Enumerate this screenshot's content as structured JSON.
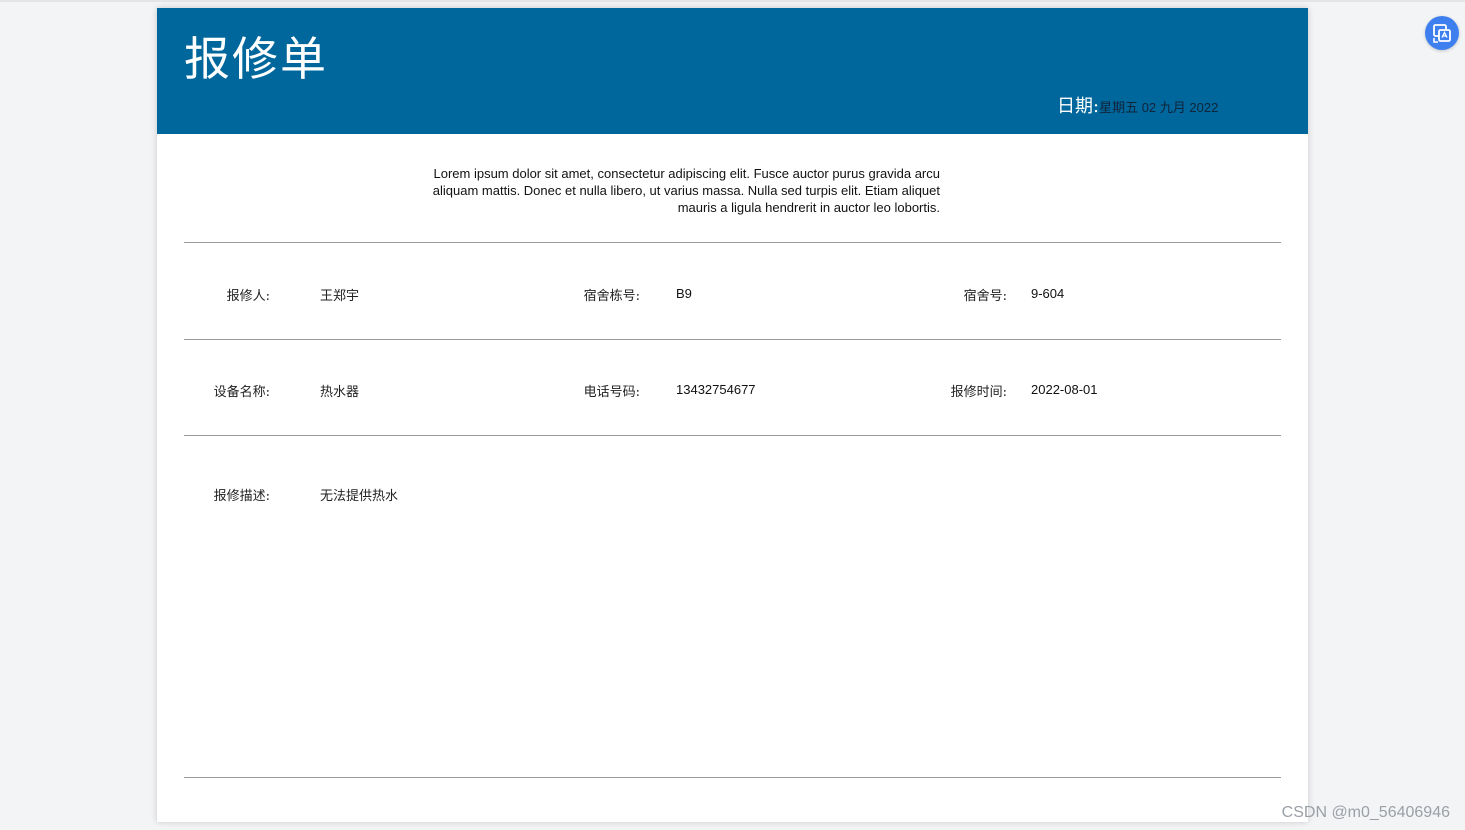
{
  "header": {
    "title": "报修单",
    "date_label": "日期:",
    "date_value": "星期五 02 九月 2022"
  },
  "intro_text": "Lorem ipsum dolor sit amet, consectetur adipiscing elit. Fusce auctor purus gravida arcu aliquam mattis. Donec et nulla libero, ut varius massa. Nulla sed turpis elit. Etiam aliquet mauris a ligula hendrerit in auctor leo lobortis.",
  "fields": {
    "reporter": {
      "label": "报修人:",
      "value": "王郑宇"
    },
    "building": {
      "label": "宿舍栋号:",
      "value": "B9"
    },
    "room": {
      "label": "宿舍号:",
      "value": "9-604"
    },
    "device": {
      "label": "设备名称:",
      "value": "热水器"
    },
    "phone": {
      "label": "电话号码:",
      "value": "13432754677"
    },
    "report_time": {
      "label": "报修时间:",
      "value": "2022-08-01"
    },
    "description": {
      "label": "报修描述:",
      "value": "无法提供热水"
    }
  },
  "watermark": "CSDN @m0_56406946",
  "colors": {
    "header_bg": "#00679c",
    "accent_button": "#3e7ff0"
  },
  "icons": {
    "floating_button": "translate-icon"
  }
}
